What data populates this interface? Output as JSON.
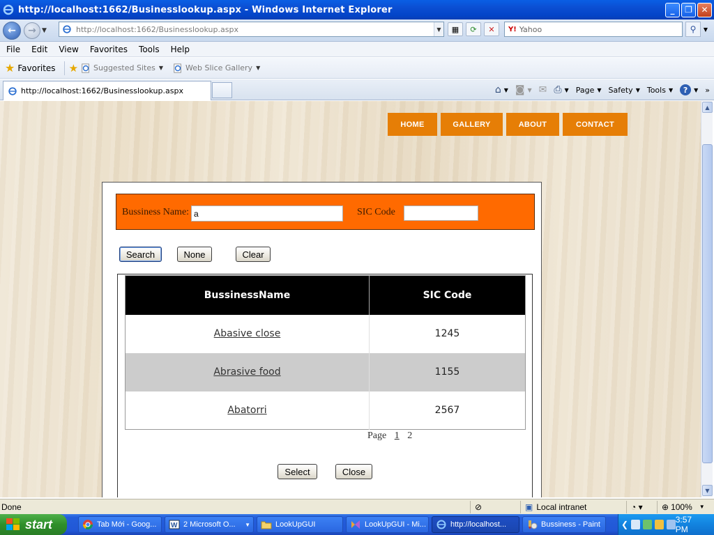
{
  "window": {
    "title": "http://localhost:1662/Businesslookup.aspx - Windows Internet Explorer"
  },
  "address_bar": {
    "url_host": "http://localhost",
    "url_rest": ":1662/Businesslookup.aspx",
    "search_placeholder": "Yahoo",
    "search_brand": "Y!"
  },
  "menu": {
    "items": [
      "File",
      "Edit",
      "View",
      "Favorites",
      "Tools",
      "Help"
    ]
  },
  "favorites_bar": {
    "label": "Favorites",
    "links": [
      "Suggested Sites",
      "Web Slice Gallery"
    ]
  },
  "tabs": {
    "active_label": "http://localhost:1662/Businesslookup.aspx"
  },
  "command_bar": {
    "page": "Page",
    "safety": "Safety",
    "tools": "Tools",
    "help": "?"
  },
  "site_nav": {
    "items": [
      "HOME",
      "GALLERY",
      "ABOUT",
      "CONTACT"
    ]
  },
  "lookup": {
    "business_name_label": "Bussiness Name:",
    "business_name_value": "a",
    "sic_label": "SIC Code",
    "sic_value": "",
    "search_button": "Search",
    "none_button": "None",
    "clear_button": "Clear",
    "columns": [
      "BussinessName",
      "SIC Code"
    ],
    "rows": [
      {
        "name": "Abasive close",
        "sic": "1245"
      },
      {
        "name": "Abrasive food",
        "sic": "1155"
      },
      {
        "name": "Abatorri",
        "sic": "2567"
      }
    ],
    "pager_label": "Page",
    "pages": [
      "1",
      "2"
    ],
    "select_button": "Select",
    "close_button": "Close"
  },
  "status_bar": {
    "status": "Done",
    "zone": "Local intranet",
    "zoom": "100%"
  },
  "taskbar": {
    "start": "start",
    "items": [
      "Tab Mới - Goog...",
      "2 Microsoft O...",
      "LookUpGUI",
      "LookUpGUI - Mi...",
      "http://localhost...",
      "Bussiness - Paint"
    ],
    "clock": "3:57 PM"
  }
}
